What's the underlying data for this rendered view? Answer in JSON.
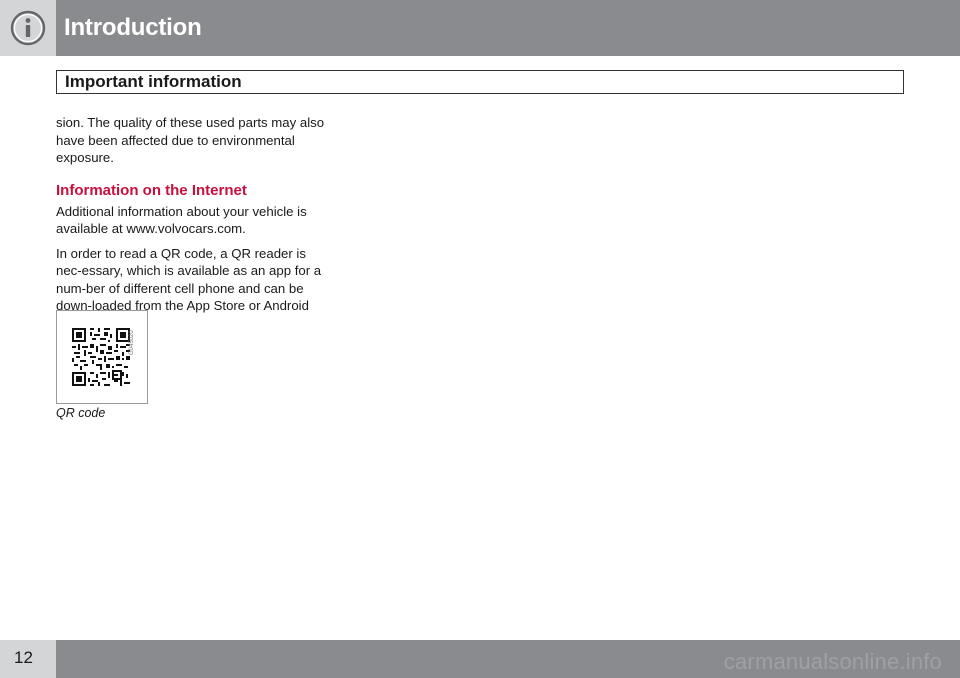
{
  "header": {
    "title": "Introduction",
    "section": "Important information",
    "icon": "info-icon"
  },
  "content": {
    "intro_paragraph": "sion. The quality of these used parts may also have been affected due to environmental exposure.",
    "heading": "Information on the Internet",
    "paragraph_1": "Additional information about your vehicle is available at  www.volvocars.com.",
    "paragraph_2": "In order to read a QR code, a QR reader is nec-essary, which is available as an app for a num-ber of different cell phone and can be down-loaded from the App Store or Android Market."
  },
  "figure": {
    "image_ref": "G045020",
    "caption": "QR code"
  },
  "footer": {
    "page_number": "12",
    "watermark": "carmanualsonline.info"
  },
  "colors": {
    "band": "#8a8b8e",
    "tab": "#d4d5d7",
    "heading": "#c8103e"
  }
}
